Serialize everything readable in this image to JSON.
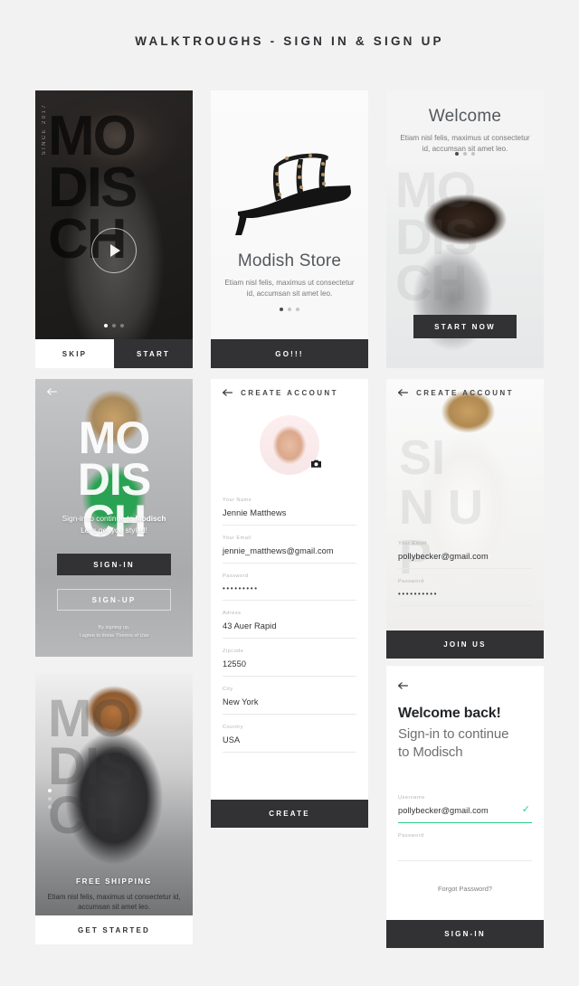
{
  "page": {
    "title": "WALKTROUGHS - SIGN IN & SIGN UP",
    "background": "#f2f2f2",
    "accent_dark": "#323234",
    "accent_green": "#2ecc87",
    "brand": "Modisch"
  },
  "screens": {
    "intro_video": {
      "name": "intro-video-screen",
      "since_label": "SINCE 2017",
      "brand_lines": [
        "MO",
        "DIS",
        "CH"
      ],
      "play_icon": "play-icon",
      "dots": {
        "count": 3,
        "active": 0
      },
      "skip_label": "SKIP",
      "start_label": "START"
    },
    "store": {
      "name": "store-screen",
      "heading": "Modish Store",
      "body": "Etiam nisl felis, maximus ut consectetur id, accumsan sit amet leo.",
      "dots": {
        "count": 3,
        "active": 0
      },
      "cta_label": "GO!!!",
      "product_icon": "high-heel-shoe"
    },
    "welcome": {
      "name": "welcome-screen",
      "heading": "Welcome",
      "body": "Etiam nisl felis, maximus ut consectetur id, accumsan sit amet leo.",
      "dots": {
        "count": 3,
        "active": 0
      },
      "cta_label": "START NOW",
      "ghost_lines": [
        "MO",
        "DIS",
        "CH"
      ]
    },
    "signin_intro": {
      "name": "signin-intro-screen",
      "back_icon": "back-arrow-icon",
      "brand_lines": [
        "MO",
        "DIS",
        "CH"
      ],
      "copy_line1_prefix": "Sign-in to continue to ",
      "copy_line1_brand": "Modisch",
      "copy_line2": "Let's get you styled!",
      "signin_label": "SIGN-IN",
      "signup_label": "SIGN-UP",
      "terms_line1": "By signing up,",
      "terms_line2": "I agree to these Therms of Use"
    },
    "free_shipping": {
      "name": "free-shipping-screen",
      "ghost_lines": [
        "MO",
        "DIS",
        "CH"
      ],
      "heading": "FREE SHIPPING",
      "body": "Etiam nisl felis, maximus ut consectetur id, accumsan sit amet leo.",
      "dots": {
        "count": 3,
        "active": 0
      },
      "cta_label": "GET STARTED"
    },
    "create_account_full": {
      "name": "create-account-full-screen",
      "back_icon": "back-arrow-icon",
      "title": "CREATE ACCOUNT",
      "avatar_name": "profile-avatar",
      "camera_icon": "camera-icon",
      "fields": [
        {
          "label": "Your Name",
          "value": "Jennie Matthews",
          "masked": false
        },
        {
          "label": "Your Email",
          "value": "jennie_matthews@gmail.com",
          "masked": false
        },
        {
          "label": "Password",
          "value": "•••••••••",
          "masked": true
        },
        {
          "label": "Adress",
          "value": "43 Auer Rapid",
          "masked": false
        },
        {
          "label": "Zipcode",
          "value": "12550",
          "masked": false
        },
        {
          "label": "City",
          "value": "New York",
          "masked": false
        },
        {
          "label": "Country",
          "value": "USA",
          "masked": false
        }
      ],
      "cta_label": "CREATE"
    },
    "create_account_short": {
      "name": "create-account-short-screen",
      "back_icon": "back-arrow-icon",
      "title": "CREATE ACCOUNT",
      "ghost_lines": [
        "SI",
        "N U",
        "P"
      ],
      "fields": [
        {
          "label": "Your Email",
          "value": "pollybecker@gmail.com",
          "masked": false
        },
        {
          "label": "Password",
          "value": "••••••••••",
          "masked": true
        }
      ],
      "cta_label": "JOIN US"
    },
    "welcome_back": {
      "name": "welcome-back-screen",
      "back_icon": "back-arrow-icon",
      "heading": "Welcome back!",
      "subheading_line1": "Sign-in to continue",
      "subheading_line2": "to Modisch",
      "fields": [
        {
          "label": "Username",
          "value": "pollybecker@gmail.com",
          "masked": false,
          "valid": true
        },
        {
          "label": "Password",
          "value": "",
          "masked": false,
          "valid": false
        }
      ],
      "check_icon": "checkmark-icon",
      "forgot_label": "Forgot Password?",
      "cta_label": "SIGN-IN"
    }
  }
}
